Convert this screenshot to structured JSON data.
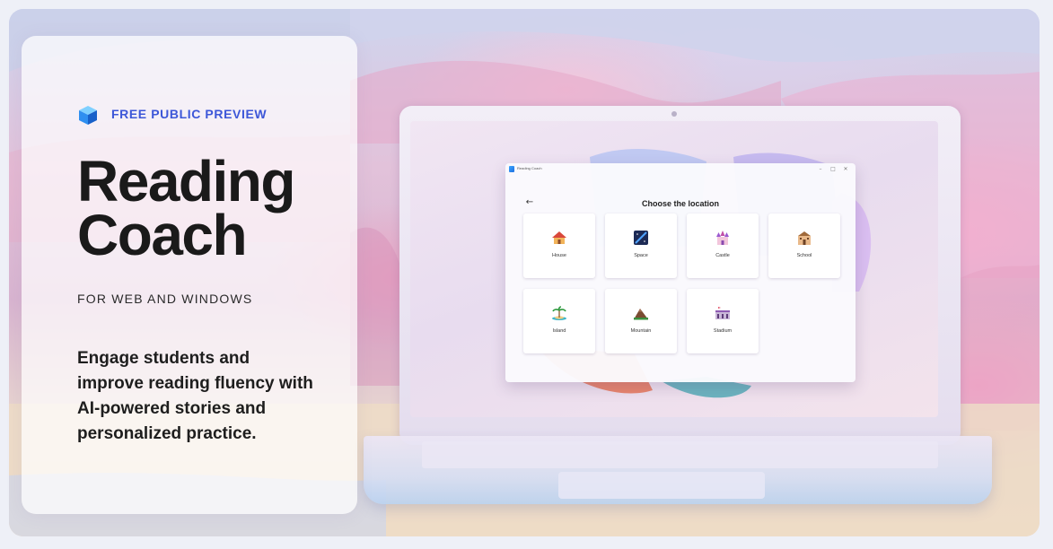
{
  "card": {
    "eyebrow": "FREE PUBLIC PREVIEW",
    "title": "Reading Coach",
    "subtitle": "FOR WEB AND WINDOWS",
    "description": "Engage students and improve reading fluency with AI-powered stories and personalized practice.",
    "eyebrow_color": "#3d57d8"
  },
  "app": {
    "window_title": "Reading Coach",
    "controls": {
      "minimize": "–",
      "maximize": "□",
      "close": "✕"
    },
    "back": "←",
    "heading": "Choose the location",
    "locations": [
      {
        "label": "House",
        "icon": "house-icon"
      },
      {
        "label": "Space",
        "icon": "space-icon"
      },
      {
        "label": "Castle",
        "icon": "castle-icon"
      },
      {
        "label": "School",
        "icon": "school-icon"
      },
      {
        "label": "Island",
        "icon": "island-icon"
      },
      {
        "label": "Mountain",
        "icon": "mountain-icon"
      },
      {
        "label": "Stadium",
        "icon": "stadium-icon"
      }
    ]
  }
}
